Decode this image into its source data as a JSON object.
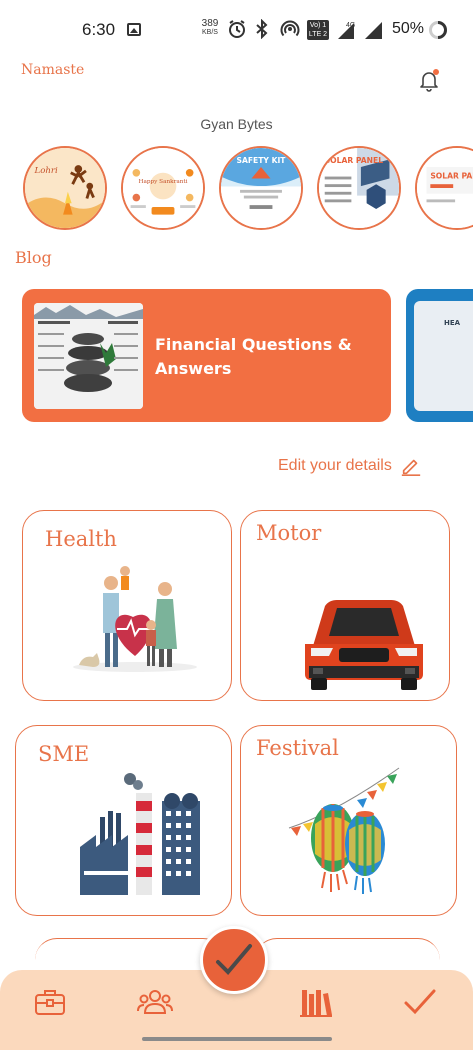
{
  "status_bar": {
    "time": "6:30",
    "net_speed_value": "389",
    "net_speed_unit": "KB/S",
    "lte_top": "Vo) 1",
    "lte_bottom": "LTE 2",
    "signal_label": "4G",
    "battery": "50%"
  },
  "header": {
    "greeting": "Namaste",
    "notification_icon": "bell-icon",
    "has_notification_dot": true
  },
  "gyan_bytes": {
    "title": "Gyan Bytes",
    "items": [
      {
        "label": "Lohri"
      },
      {
        "label": "Happy Sankranti"
      },
      {
        "label": "SAFETY KIT"
      },
      {
        "label": "SOLAR PANEL"
      },
      {
        "label": "SOLAR PANEL"
      }
    ]
  },
  "blog": {
    "title": "Blog",
    "cards": [
      {
        "title": "Financial Questions & Answers"
      },
      {
        "title": "HEA"
      }
    ]
  },
  "edit_details": {
    "label": "Edit your details",
    "icon": "pencil-icon"
  },
  "categories": [
    {
      "label": "Health",
      "icon": "family-heart-icon"
    },
    {
      "label": "Motor",
      "icon": "car-icon"
    },
    {
      "label": "SME",
      "icon": "factory-icon"
    },
    {
      "label": "Festival",
      "icon": "lantern-icon"
    }
  ],
  "bottom_nav": {
    "items": [
      {
        "icon": "briefcase-icon"
      },
      {
        "icon": "people-icon"
      },
      {
        "icon": "library-icon",
        "active": true
      },
      {
        "icon": "checkmark-icon"
      }
    ],
    "fab_icon": "checkmark-icon"
  },
  "colors": {
    "accent": "#e8744a",
    "blog_card": "#f26f42",
    "nav_bg": "#fbd9bd",
    "fab": "#e8623a"
  }
}
